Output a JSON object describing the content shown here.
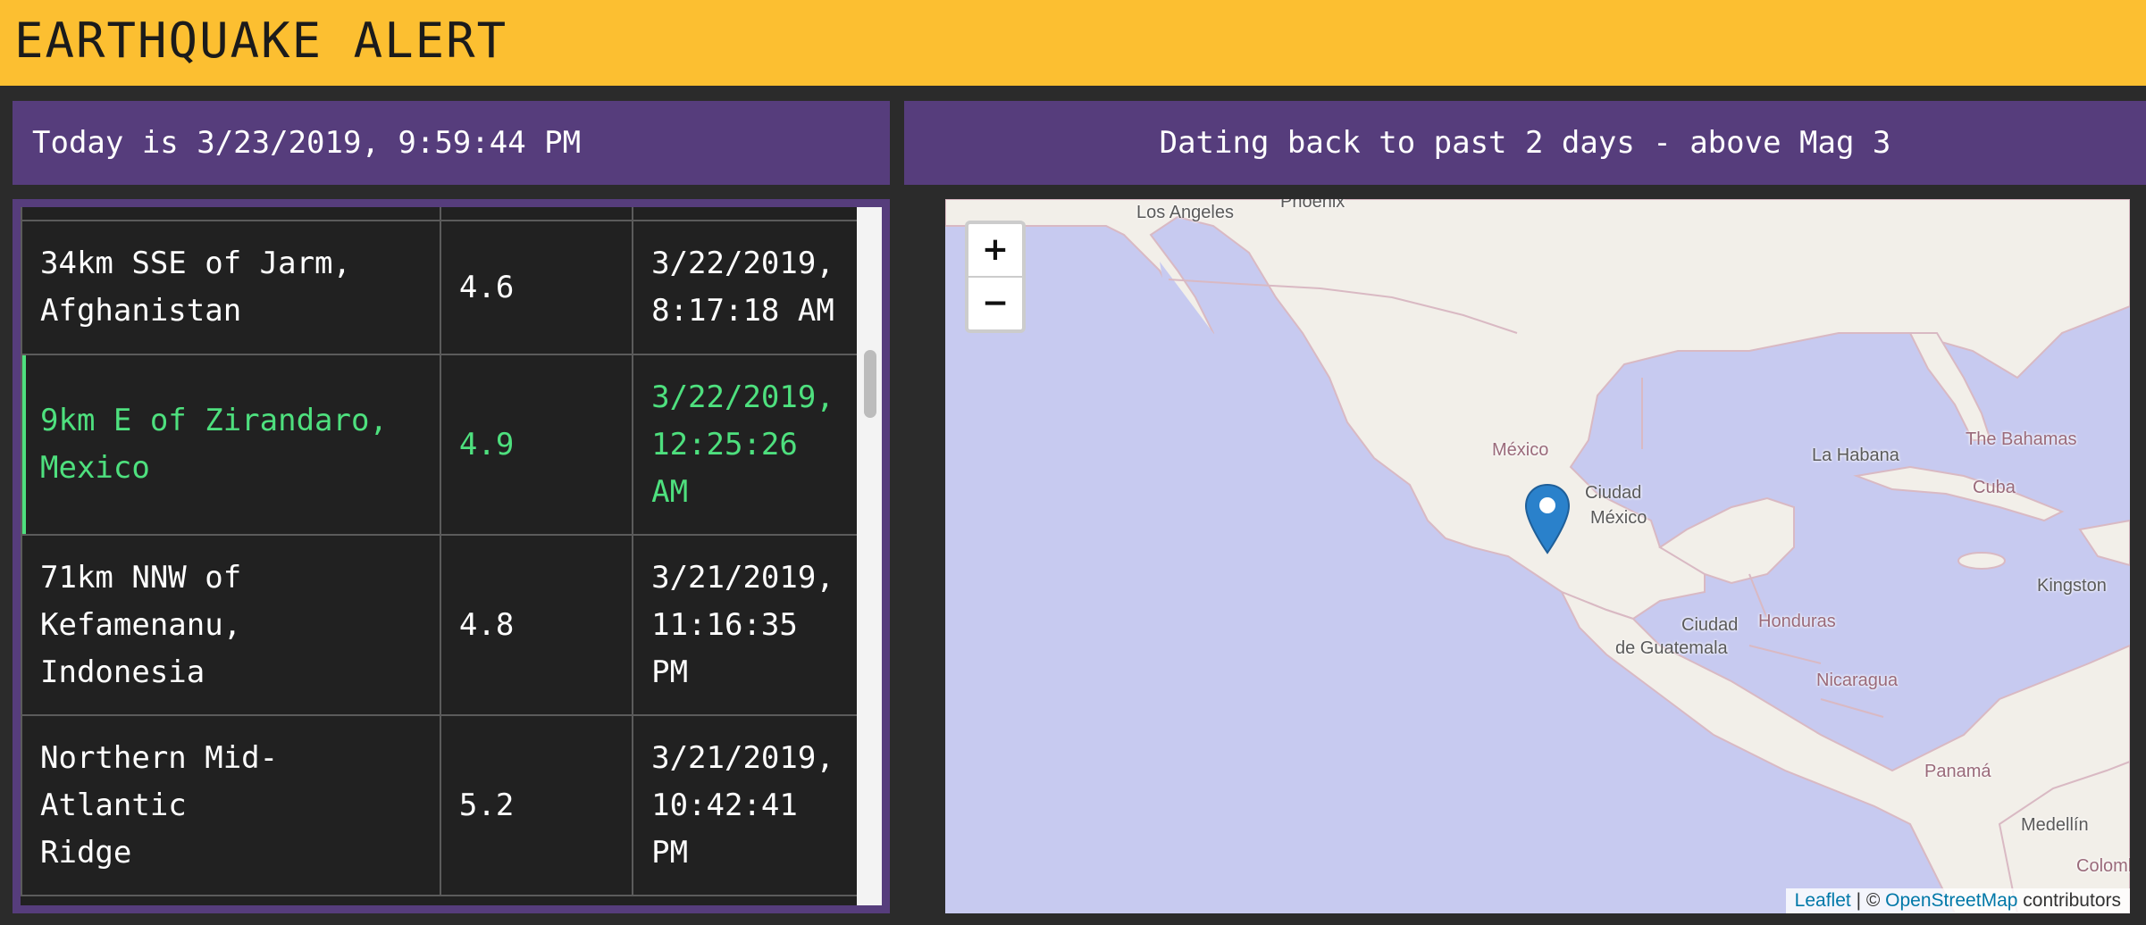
{
  "header": {
    "title": "EARTHQUAKE ALERT"
  },
  "left_panel": {
    "today": "Today is 3/23/2019, 9:59:44 PM"
  },
  "right_panel": {
    "subtitle": "Dating back to past 2 days - above Mag 3"
  },
  "quakes": [
    {
      "location_line1": "34km SSE of Jarm,",
      "location_line2": "Afghanistan",
      "magnitude": "4.6",
      "time_line1": "3/22/2019,",
      "time_line2": "8:17:18 AM",
      "time_line3": ""
    },
    {
      "location_line1": "9km E of Zirandaro,",
      "location_line2": "Mexico",
      "magnitude": "4.9",
      "time_line1": "3/22/2019,",
      "time_line2": "12:25:26",
      "time_line3": "AM",
      "selected": true
    },
    {
      "location_line1": "71km NNW of",
      "location_line2": "Kefamenanu, Indonesia",
      "magnitude": "4.8",
      "time_line1": "3/21/2019,",
      "time_line2": "11:16:35",
      "time_line3": "PM"
    },
    {
      "location_line1": "Northern Mid-Atlantic",
      "location_line2": "Ridge",
      "magnitude": "5.2",
      "time_line1": "3/21/2019,",
      "time_line2": "10:42:41",
      "time_line3": "PM"
    }
  ],
  "map": {
    "zoom_in": "+",
    "zoom_out": "−",
    "labels": {
      "los_angeles": "Los Angeles",
      "phoenix": "Phoenix",
      "mexico_country": "México",
      "mexico_city_1": "Ciudad",
      "mexico_city_2": "México",
      "la_habana": "La Habana",
      "bahamas": "The Bahamas",
      "cuba": "Cuba",
      "kingston": "Kingston",
      "honduras": "Honduras",
      "guatemala_1": "Ciudad",
      "guatemala_2": "de Guatemala",
      "nicaragua": "Nicaragua",
      "panama": "Panamá",
      "medellin": "Medellín",
      "colombia": "Colomb"
    },
    "attribution": {
      "leaflet": "Leaflet",
      "sep": " | © ",
      "osm": "OpenStreetMap",
      "contributors": " contributors"
    },
    "colors": {
      "water": "#c7caf0",
      "land": "#f2efe9",
      "marker": "#2a81cb"
    }
  }
}
